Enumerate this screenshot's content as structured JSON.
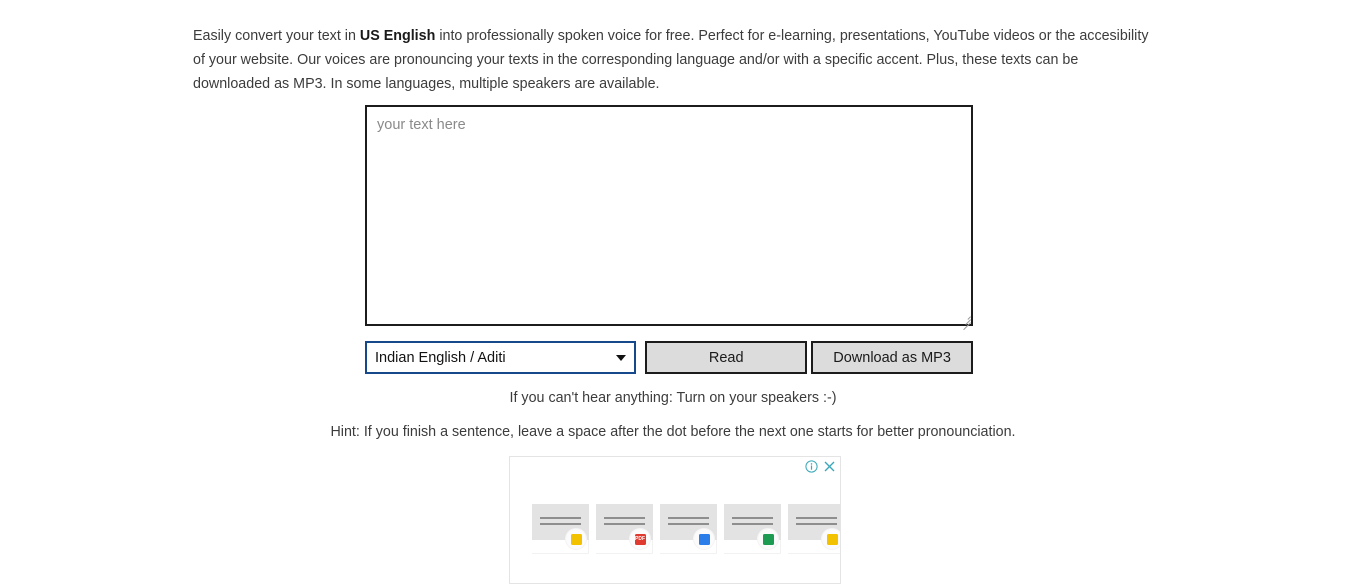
{
  "intro": {
    "part1": "Easily convert your text in ",
    "highlight": "US English",
    "part2": " into professionally spoken voice for free. Perfect for e-learning, presentations, YouTube videos or the accesibility of your website. Our voices are pronouncing your texts in the corresponding language and/or with a specific accent. Plus, these texts can be downloaded as MP3. In some languages, multiple speakers are available."
  },
  "editor": {
    "placeholder": "your text here",
    "value": ""
  },
  "controls": {
    "voice_selected": "Indian English / Aditi",
    "caret_icon": "chevron-down-icon",
    "read_label": "Read",
    "download_label": "Download as MP3"
  },
  "notes": {
    "speakers": "If you can't hear anything: Turn on your speakers :-)",
    "hint": "Hint: If you finish a sentence, leave a space after the dot before the next one starts for better pronounciation."
  },
  "ad": {
    "info_icon": "info-circle-icon",
    "close_icon": "close-icon",
    "control_color": "#3aa8b8",
    "cards": [
      {
        "badge_color": "#f2c200",
        "badge_label": ""
      },
      {
        "badge_color": "#e03a2f",
        "badge_label": "PDF"
      },
      {
        "badge_color": "#2b7de9",
        "badge_label": ""
      },
      {
        "badge_color": "#1e9b52",
        "badge_label": ""
      },
      {
        "badge_color": "#f2c200",
        "badge_label": ""
      }
    ]
  }
}
